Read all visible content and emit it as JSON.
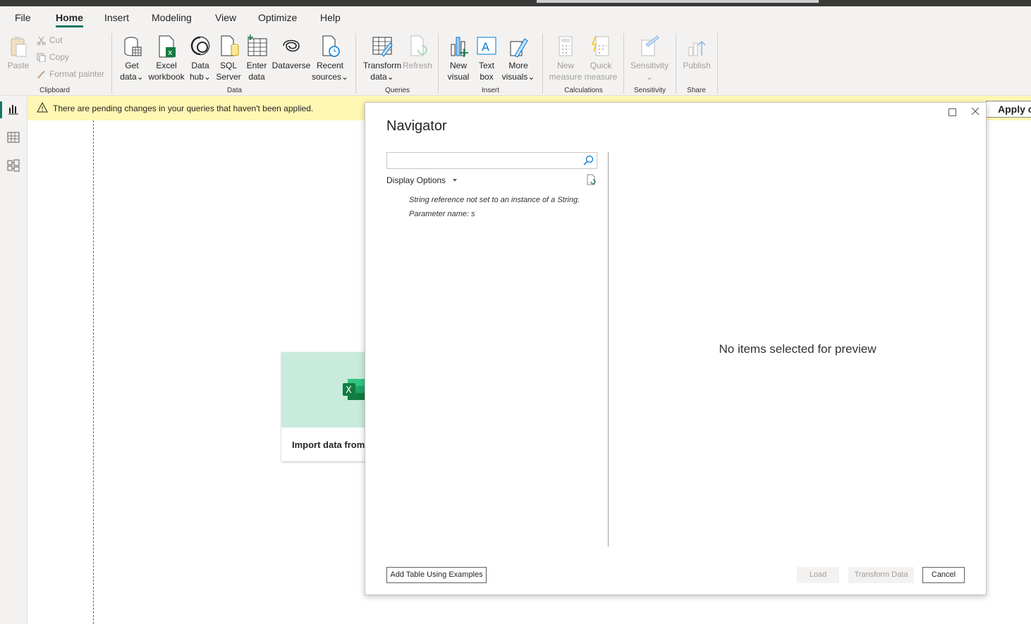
{
  "menu": {
    "file": "File",
    "home": "Home",
    "insert": "Insert",
    "modeling": "Modeling",
    "view": "View",
    "optimize": "Optimize",
    "help": "Help"
  },
  "ribbon": {
    "clipboard": {
      "paste": "Paste",
      "cut": "Cut",
      "copy": "Copy",
      "format_painter": "Format painter",
      "label": "Clipboard"
    },
    "data": {
      "get_data": [
        "Get",
        "data"
      ],
      "excel": [
        "Excel",
        "workbook"
      ],
      "data_hub": [
        "Data",
        "hub"
      ],
      "sql": [
        "SQL",
        "Server"
      ],
      "enter_data": [
        "Enter",
        "data"
      ],
      "dataverse": "Dataverse",
      "recent": [
        "Recent",
        "sources"
      ],
      "label": "Data"
    },
    "queries": {
      "transform": [
        "Transform",
        "data"
      ],
      "refresh": "Refresh",
      "label": "Queries"
    },
    "insert": {
      "new_visual": [
        "New",
        "visual"
      ],
      "text_box": [
        "Text",
        "box"
      ],
      "more_visuals": [
        "More",
        "visuals"
      ],
      "label": "Insert"
    },
    "calculations": {
      "new_measure": [
        "New",
        "measure"
      ],
      "quick_measure": [
        "Quick",
        "measure"
      ],
      "label": "Calculations"
    },
    "sensitivity": {
      "btn": "Sensitivity",
      "label": "Sensitivity"
    },
    "share": {
      "publish": "Publish",
      "label": "Share"
    }
  },
  "warning": {
    "text": "There are pending changes in your queries that haven't been applied.",
    "apply": "Apply c"
  },
  "card": {
    "text": "Import data from"
  },
  "navigator": {
    "title": "Navigator",
    "search_value": "",
    "display_options": "Display Options",
    "error_line1": "String reference not set to an instance of a String.",
    "error_line2": "Parameter name: s",
    "no_items": "No items selected for preview",
    "add_table": "Add Table Using Examples",
    "load": "Load",
    "transform": "Transform Data",
    "cancel": "Cancel"
  },
  "colors": {
    "accent": "#117865",
    "warning_bg": "#fff7b3",
    "excel_green": "#107c41"
  }
}
